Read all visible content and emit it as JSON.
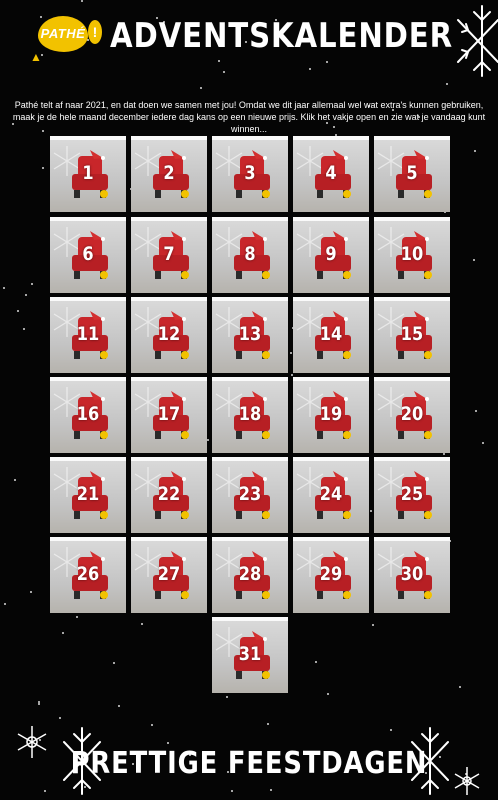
{
  "header": {
    "logo_text": "PATHÉ",
    "logo_mark": "!",
    "title": "ADVENTSKALENDER"
  },
  "intro": "Pathé telt af naar 2021, en dat doen we samen met jou! Omdat we dit jaar allemaal wel wat extra's kunnen gebruiken, maak je de hele maand december iedere dag kans op een nieuwe prijs. Klik het vakje open en zie wat je vandaag kunt winnen...",
  "calendar": {
    "days": [
      "1",
      "2",
      "3",
      "4",
      "5",
      "6",
      "7",
      "8",
      "9",
      "10",
      "11",
      "12",
      "13",
      "14",
      "15",
      "16",
      "17",
      "18",
      "19",
      "20",
      "21",
      "22",
      "23",
      "24",
      "25",
      "26",
      "27",
      "28",
      "29",
      "30",
      "31"
    ],
    "tile_icon": "cinema-chair-santa-hat-icon"
  },
  "footer": {
    "title": "PRETTIGE FEESTDAGEN"
  },
  "colors": {
    "background": "#050505",
    "brand_yellow": "#f2c200",
    "chair_red": "#c8262a"
  }
}
